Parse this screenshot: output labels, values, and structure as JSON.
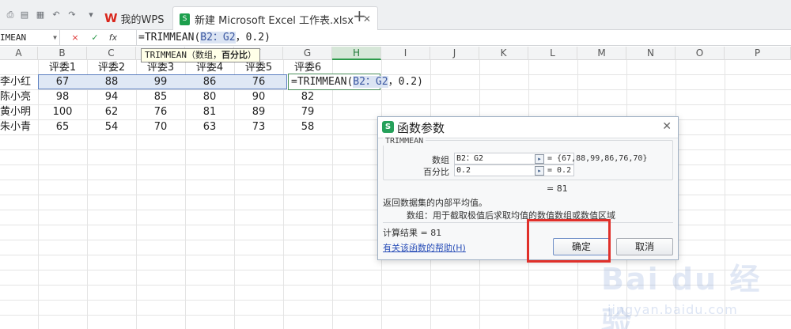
{
  "tabs": [
    {
      "label": "我的WPS"
    },
    {
      "label": "新建 Microsoft Excel 工作表.xlsx"
    }
  ],
  "formula_bar": {
    "namebox": "IMEAN",
    "cancel": "×",
    "confirm": "✓",
    "fx": "fx",
    "formula_prefix": "=TRIMMEAN(",
    "formula_ref": "B2：G2",
    "formula_suffix": "，0.2)"
  },
  "columns": [
    "A",
    "B",
    "C",
    "D",
    "E",
    "F",
    "G",
    "H",
    "I",
    "J",
    "K",
    "L",
    "M",
    "N",
    "O",
    "P"
  ],
  "tooltip": {
    "prefix": "TRIMMEAN（数组，",
    "bold": "百分比",
    "suffix": "）"
  },
  "sheet": {
    "headers": [
      "评委1",
      "评委2",
      "评委3",
      "评委4",
      "评委5",
      "评委6"
    ],
    "rows": [
      {
        "name": "李小红",
        "scores": [
          "67",
          "88",
          "99",
          "86",
          "76",
          "70"
        ]
      },
      {
        "name": "陈小亮",
        "scores": [
          "98",
          "94",
          "85",
          "80",
          "90",
          "82"
        ]
      },
      {
        "name": "黄小明",
        "scores": [
          "100",
          "62",
          "76",
          "81",
          "89",
          "79"
        ]
      },
      {
        "name": "朱小青",
        "scores": [
          "65",
          "54",
          "70",
          "63",
          "73",
          "58"
        ]
      }
    ],
    "edit_prefix": "=TRIMMEAN(",
    "edit_ref": "B2：G2",
    "edit_suffix": "，0.2)"
  },
  "dialog": {
    "title": "函数参数",
    "logo": "S",
    "function_name": "TRIMMEAN",
    "args": [
      {
        "label": "数组",
        "value": "B2：G2",
        "result": "= {67,88,99,86,76,70}"
      },
      {
        "label": "百分比",
        "value": "0.2",
        "result": "= 0.2"
      }
    ],
    "overall_result": "= 81",
    "description": "返回数据集的内部平均值。",
    "param_help": "数组：用于截取极值后求取均值的数值数组或数值区域",
    "calc_result": "计算结果 = 81",
    "help_link": "有关该函数的帮助(H)",
    "ok_label": "确定",
    "cancel_label": "取消"
  },
  "watermark": {
    "main": "Bai du 经验",
    "sub": "jingyan.baidu.com"
  },
  "colors": {
    "accent_green": "#2c9a4a",
    "selection_blue": "#5b7fc0",
    "highlight_red": "#e0302a",
    "wps_red": "#d9261c"
  }
}
